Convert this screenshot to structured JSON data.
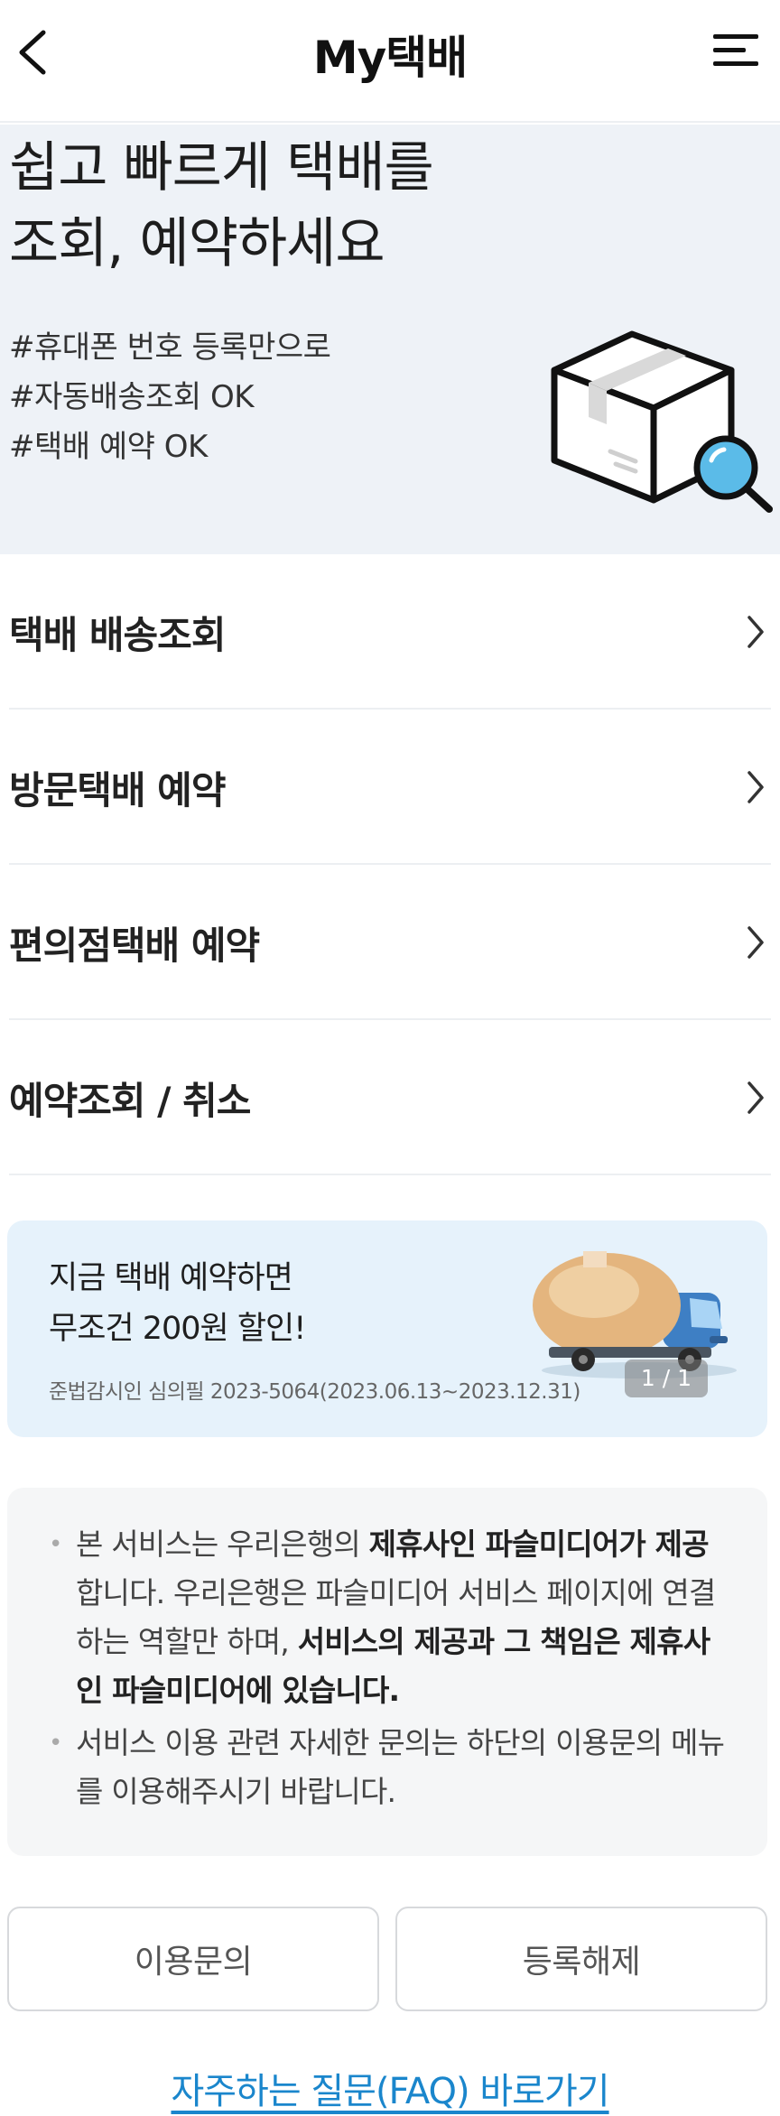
{
  "header": {
    "title": "My택배",
    "back_icon": "chevron-left-icon",
    "menu_icon": "hamburger-menu-icon"
  },
  "hero": {
    "headline_line1": "쉽고 빠르게 택배를",
    "headline_line2": "조회, 예약하세요",
    "tags": [
      "#휴대폰 번호 등록만으로",
      "#자동배송조회 OK",
      "#택배 예약 OK"
    ],
    "illustration": "package-search-icon"
  },
  "menu": [
    {
      "label": "택배 배송조회"
    },
    {
      "label": "방문택배 예약"
    },
    {
      "label": "편의점택배 예약"
    },
    {
      "label": "예약조회 / 취소"
    }
  ],
  "promo": {
    "line1": "지금 택배 예약하면",
    "line2": "무조건 200원 할인!",
    "compliance": "준법감시인 심의필 2023-5064(2023.06.13~2023.12.31)",
    "pager": "1 / 1"
  },
  "notice": {
    "item1_pre": "본 서비스는 우리은행의 ",
    "item1_bold1": "제휴사인 파슬미디어가 제공",
    "item1_mid": "합니다. 우리은행은 파슬미디어 서비스 페이지에 연결하는 역할만 하며, ",
    "item1_bold2": "서비스의 제공과 그 책임은 제휴사인 파슬미디어에 있습니다.",
    "item2": "서비스 이용 관련 자세한 문의는 하단의 이용문의 메뉴를 이용해주시기 바랍니다."
  },
  "buttons": {
    "inquiry": "이용문의",
    "unregister": "등록해제"
  },
  "faq_link": "자주하는 질문(FAQ) 바로가기",
  "colors": {
    "hero_bg": "#eef2f7",
    "promo_bg": "#e6f2fb",
    "notice_bg": "#f5f6f7",
    "link": "#1a86cc",
    "accent_blue": "#5bbbe8"
  }
}
